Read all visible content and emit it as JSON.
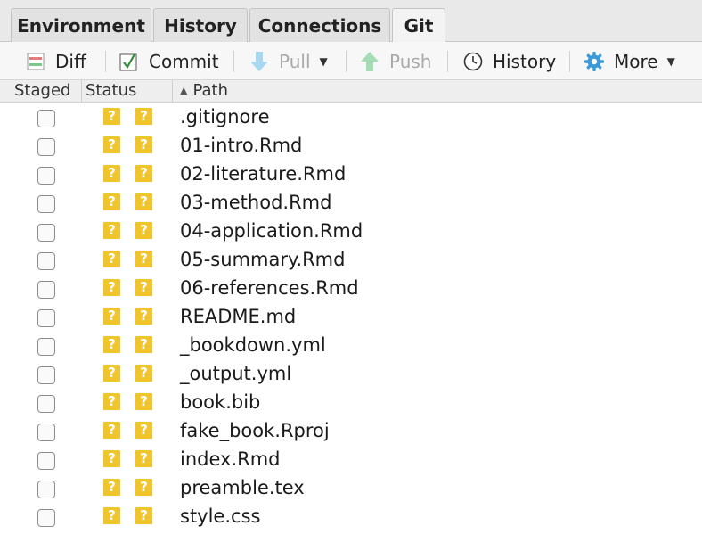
{
  "tabs": [
    {
      "label": "Environment",
      "active": false
    },
    {
      "label": "History",
      "active": false
    },
    {
      "label": "Connections",
      "active": false
    },
    {
      "label": "Git",
      "active": true
    }
  ],
  "toolbar": {
    "diff": "Diff",
    "commit": "Commit",
    "pull": "Pull",
    "push": "Push",
    "history": "History",
    "more": "More"
  },
  "columns": {
    "staged": "Staged",
    "status": "Status",
    "path": "Path"
  },
  "status_icon": "?",
  "files": [
    {
      "path": ".gitignore"
    },
    {
      "path": "01-intro.Rmd"
    },
    {
      "path": "02-literature.Rmd"
    },
    {
      "path": "03-method.Rmd"
    },
    {
      "path": "04-application.Rmd"
    },
    {
      "path": "05-summary.Rmd"
    },
    {
      "path": "06-references.Rmd"
    },
    {
      "path": "README.md"
    },
    {
      "path": "_bookdown.yml"
    },
    {
      "path": "_output.yml"
    },
    {
      "path": "book.bib"
    },
    {
      "path": "fake_book.Rproj"
    },
    {
      "path": "index.Rmd"
    },
    {
      "path": "preamble.tex"
    },
    {
      "path": "style.css"
    }
  ],
  "colors": {
    "status_untracked": "#f0c52b",
    "push_pull_disabled": "#9fd7b0",
    "more_gear": "#3a9ad9"
  }
}
